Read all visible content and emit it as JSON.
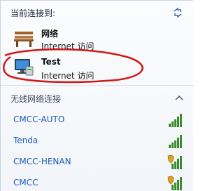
{
  "header": {
    "label": "当前连接到:"
  },
  "connections": [
    {
      "name": "网络",
      "status": "Internet 访问",
      "icon": "bench-network-icon"
    },
    {
      "name": "Test",
      "status": "Internet 访问",
      "icon": "computer-network-icon"
    }
  ],
  "wireless_section": {
    "label": "无线网络连接",
    "chevron": "chevron-up-icon"
  },
  "networks": [
    {
      "name": "CMCC-AUTO",
      "signal_bars": 5,
      "secured": false
    },
    {
      "name": "Tenda",
      "signal_bars": 5,
      "secured": false
    },
    {
      "name": "CMCC-HENAN",
      "signal_bars": 5,
      "secured": true
    },
    {
      "name": "CMCC",
      "signal_bars": 5,
      "secured": true
    }
  ],
  "colors": {
    "link": "#1f5bb8",
    "signal": "#3a8c2f",
    "annotation": "#d01818",
    "shield": "#e0a11e"
  }
}
